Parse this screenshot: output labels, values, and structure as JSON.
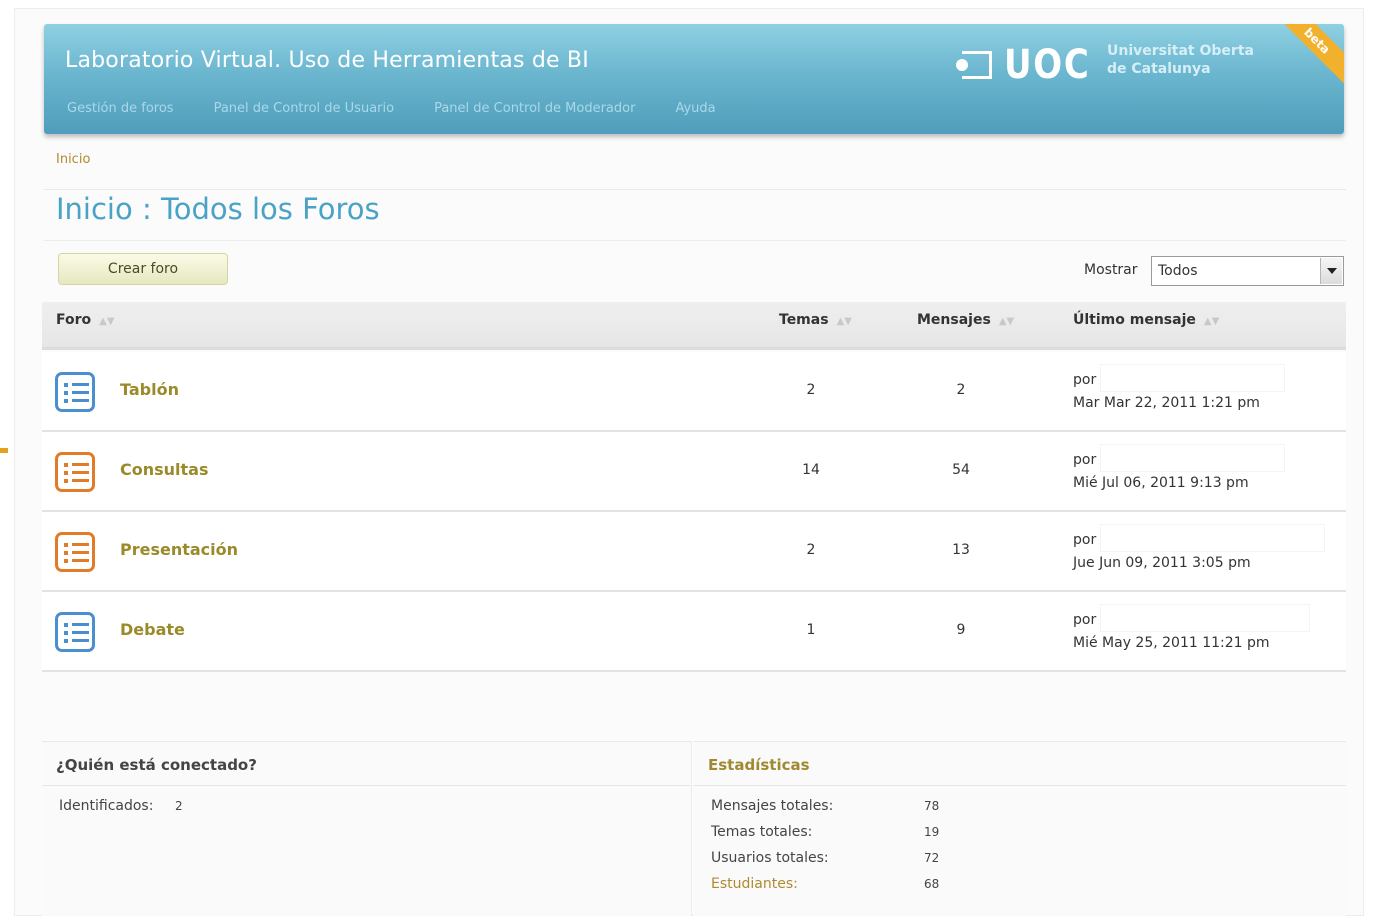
{
  "header": {
    "app_title": "Laboratorio Virtual. Uso de Herramientas de BI",
    "nav": [
      "Gestión de foros",
      "Panel de Control de Usuario",
      "Panel de Control de Moderador",
      "Ayuda"
    ],
    "logo_text": "UOC",
    "logo_sub_line1": "Universitat Oberta",
    "logo_sub_line2": "de Catalunya",
    "ribbon": "beta"
  },
  "breadcrumb": "Inicio",
  "page_title": "Inicio : Todos los Foros",
  "create_button": "Crear foro",
  "filter": {
    "label": "Mostrar",
    "value": "Todos"
  },
  "table": {
    "columns": [
      "Foro",
      "Temas",
      "Mensajes",
      "Último mensaje"
    ],
    "rows": [
      {
        "name": "Tablón",
        "temas": "2",
        "mensajes": "2",
        "por": "por",
        "date": "Mar Mar 22, 2011 1:21 pm",
        "icon_color": "#4a8fd0",
        "icon": "list-icon"
      },
      {
        "name": "Consultas",
        "temas": "14",
        "mensajes": "54",
        "por": "por",
        "date": "Mié Jul 06, 2011 9:13 pm",
        "icon_color": "#e07b2a",
        "icon": "list-icon"
      },
      {
        "name": "Presentación",
        "temas": "2",
        "mensajes": "13",
        "por": "por",
        "date": "Jue Jun 09, 2011 3:05 pm",
        "icon_color": "#e07b2a",
        "icon": "list-icon"
      },
      {
        "name": "Debate",
        "temas": "1",
        "mensajes": "9",
        "por": "por",
        "date": "Mié May 25, 2011 11:21 pm",
        "icon_color": "#4a8fd0",
        "icon": "list-icon"
      }
    ]
  },
  "who_online": {
    "title": "¿Quién está conectado?",
    "identified_label": "Identificados:",
    "identified_value": "2"
  },
  "stats": {
    "title": "Estadísticas",
    "items": [
      {
        "label": "Mensajes totales:",
        "value": "78"
      },
      {
        "label": "Temas totales:",
        "value": "19"
      },
      {
        "label": "Usuarios totales:",
        "value": "72"
      },
      {
        "label": "Estudiantes:",
        "value": "68"
      }
    ]
  },
  "colors": {
    "header_gradient_top": "#8fd0e2",
    "header_gradient_bottom": "#4f9dbb",
    "title_blue": "#4aa3c6",
    "forum_link": "#9a8a2a",
    "ribbon": "#f2b12c"
  }
}
